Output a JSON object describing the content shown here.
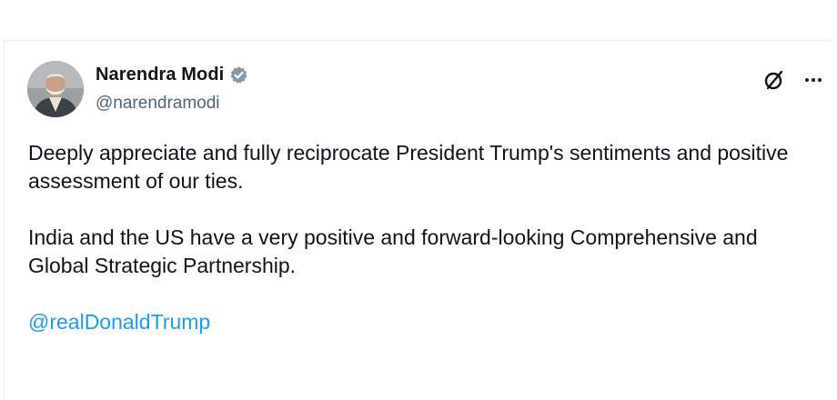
{
  "author": {
    "name": "Narendra Modi",
    "handle": "@narendramodi",
    "verified": true
  },
  "tweet": {
    "paragraphs": [
      "Deeply appreciate and fully reciprocate President Trump's sentiments and positive assessment of our ties.",
      "India and the US have a very positive and forward-looking Comprehensive and Global Strategic Partnership."
    ],
    "mention": "@realDonaldTrump"
  },
  "icons": {
    "verified": "verified-badge-icon",
    "grok": "grok-icon",
    "more": "more-icon"
  },
  "colors": {
    "text": "#0f1419",
    "secondary": "#536471",
    "link": "#1d9bf0",
    "verified": "#829aab"
  }
}
